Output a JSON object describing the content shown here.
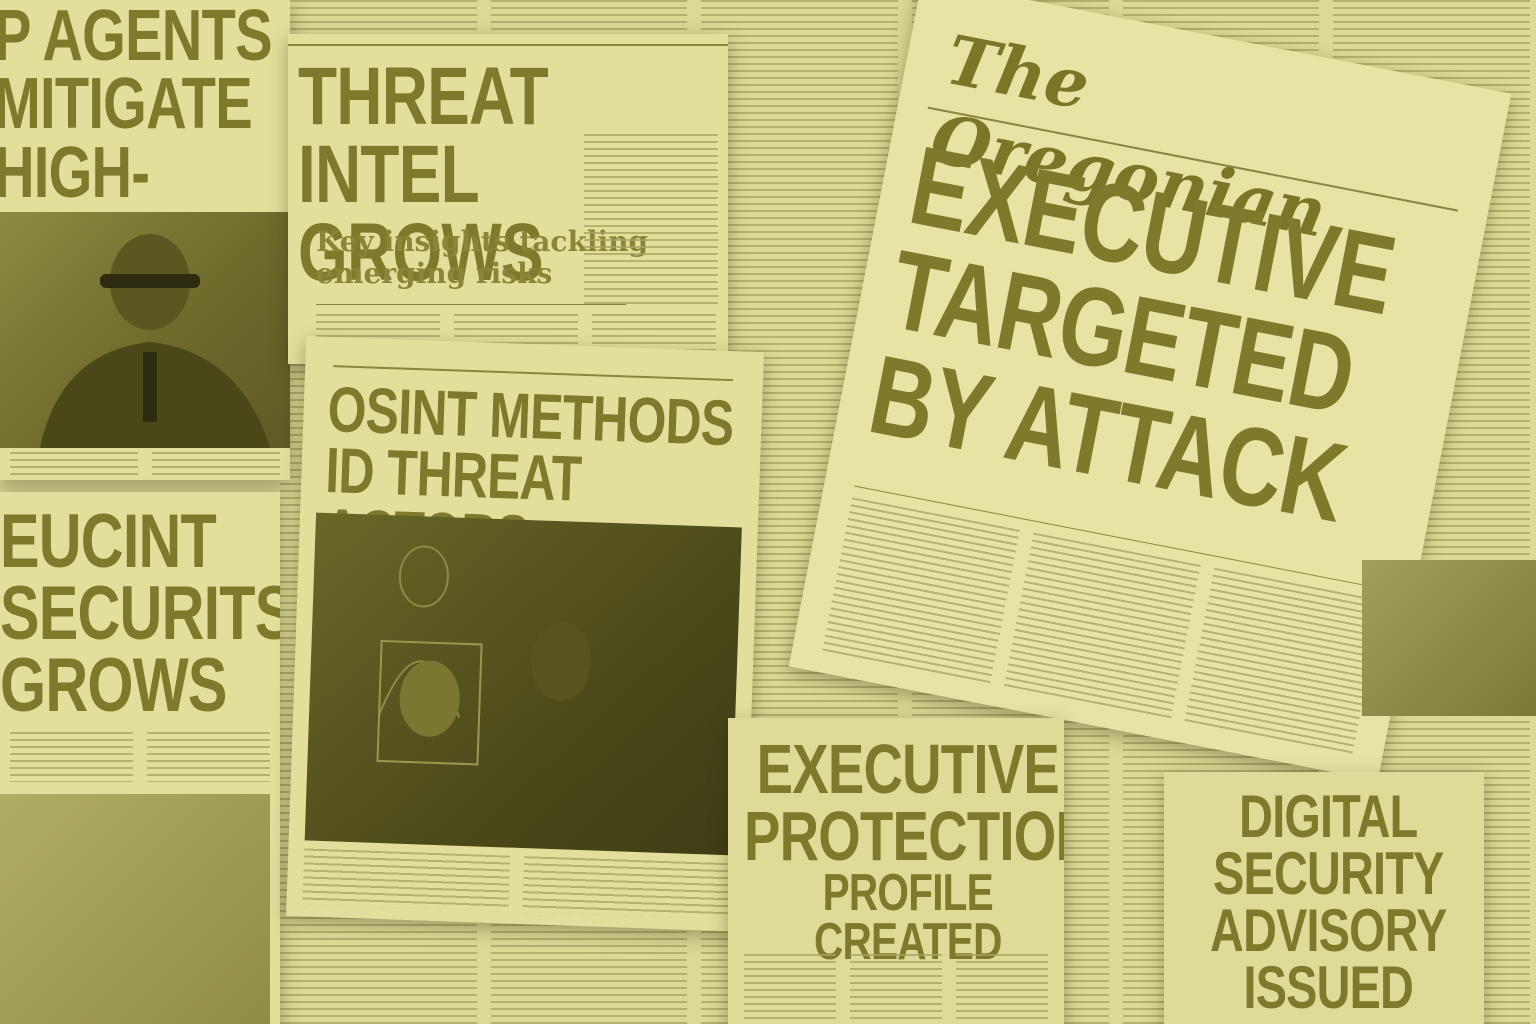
{
  "papers": {
    "left_top": {
      "headline_lines": [
        "P AGENTS",
        "MITIGATE",
        "HIGH-THREAT"
      ]
    },
    "left_mid": {
      "headline_lines": [
        "EUCINT",
        "SECURITS",
        "GROWS"
      ]
    },
    "threat_intel": {
      "headline_lines": [
        "THREAT INTEL",
        "GROWS"
      ],
      "subhead_lines": [
        "Key insights tackling",
        "emerging risks"
      ]
    },
    "osint": {
      "headline_lines": [
        "OSINT METHODS",
        "ID THREAT ACTORS"
      ]
    },
    "oregonian": {
      "masthead": "The Oregonian",
      "headline_lines": [
        "EXECUTIVE",
        "TARGETED",
        "BY ATTACK"
      ]
    },
    "exec_protection": {
      "headline_lines": [
        "EXECUTIVE",
        "PROTECTION",
        "PROFILE CREATED"
      ]
    },
    "digital_security": {
      "headline_lines": [
        "DIGITAL",
        "SECURITY",
        "ADVISORY",
        "ISSUED"
      ]
    }
  }
}
